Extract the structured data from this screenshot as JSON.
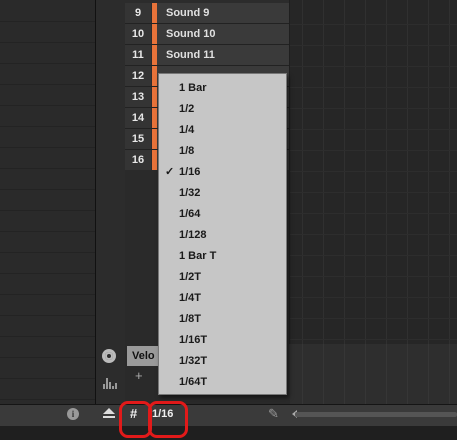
{
  "sounds": [
    {
      "num": "9",
      "name": "Sound 9"
    },
    {
      "num": "10",
      "name": "Sound 10"
    },
    {
      "num": "11",
      "name": "Sound 11"
    },
    {
      "num": "12",
      "name": ""
    },
    {
      "num": "13",
      "name": ""
    },
    {
      "num": "14",
      "name": ""
    },
    {
      "num": "15",
      "name": ""
    },
    {
      "num": "16",
      "name": ""
    }
  ],
  "sound_color": "#e8733a",
  "velocity_tab": {
    "label": "Velo"
  },
  "plus_symbol": "+",
  "bottom_bar": {
    "info_symbol": "i",
    "grid_symbol": "#",
    "step_value": "1/16",
    "pencil_symbol": "✎"
  },
  "dropdown": {
    "items": [
      {
        "label": "1 Bar",
        "checked": false
      },
      {
        "label": "1/2",
        "checked": false
      },
      {
        "label": "1/4",
        "checked": false
      },
      {
        "label": "1/8",
        "checked": false
      },
      {
        "label": "1/16",
        "checked": true
      },
      {
        "label": "1/32",
        "checked": false
      },
      {
        "label": "1/64",
        "checked": false
      },
      {
        "label": "1/128",
        "checked": false
      },
      {
        "label": "1 Bar T",
        "checked": false
      },
      {
        "label": "1/2T",
        "checked": false
      },
      {
        "label": "1/4T",
        "checked": false
      },
      {
        "label": "1/8T",
        "checked": false
      },
      {
        "label": "1/16T",
        "checked": false
      },
      {
        "label": "1/32T",
        "checked": false
      },
      {
        "label": "1/64T",
        "checked": false
      }
    ],
    "check_symbol": "✓"
  },
  "annotation_color": "#e21a1a"
}
